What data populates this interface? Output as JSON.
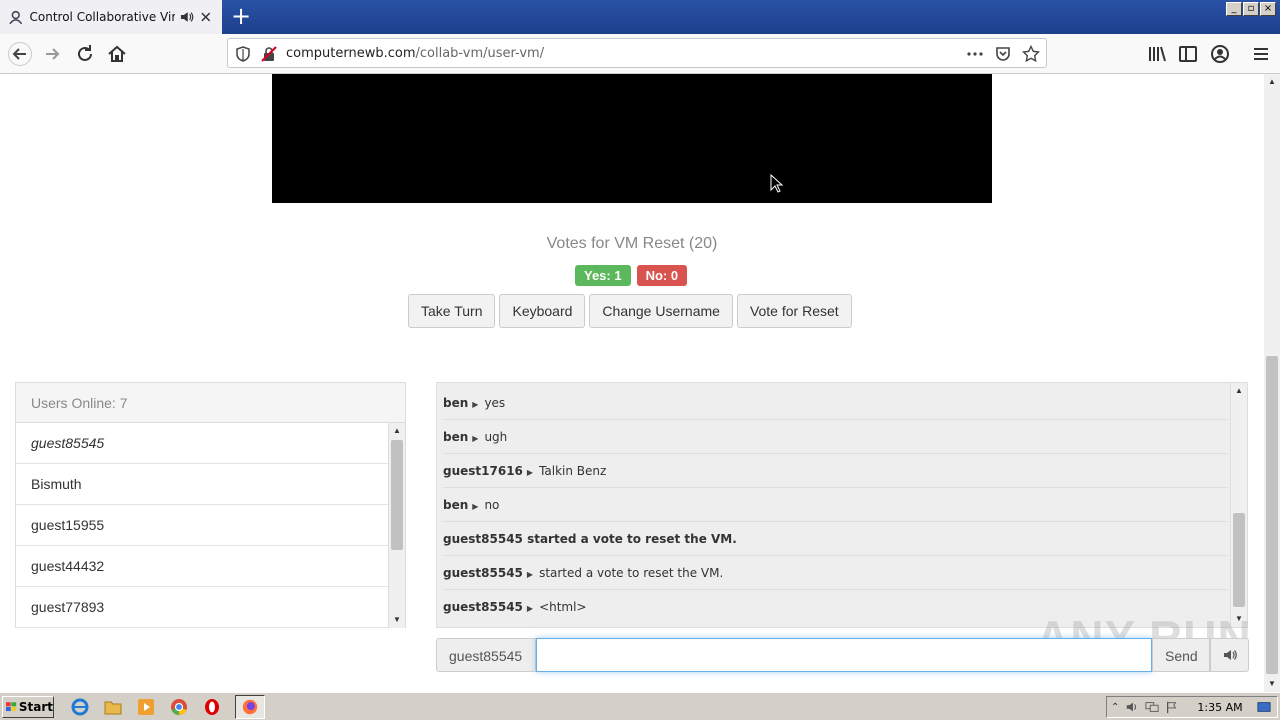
{
  "browser": {
    "tab_title": "Control Collaborative Virtual M",
    "url_domain": "computernewb.com",
    "url_path": "/collab-vm/user-vm/",
    "window_buttons": [
      "_",
      "▫",
      "×"
    ]
  },
  "vote": {
    "title": "Votes for VM Reset (20)",
    "yes_label": "Yes: 1",
    "no_label": "No: 0"
  },
  "buttons": {
    "take_turn": "Take Turn",
    "keyboard": "Keyboard",
    "change_username": "Change Username",
    "vote_reset": "Vote for Reset"
  },
  "users": {
    "header": "Users Online: 7",
    "list": [
      "guest85545",
      "Bismuth",
      "guest15955",
      "guest44432",
      "guest77893"
    ]
  },
  "chat": {
    "messages": [
      {
        "nick": "ben",
        "text": "yes"
      },
      {
        "nick": "ben",
        "text": "ugh"
      },
      {
        "nick": "guest17616",
        "text": "Talkin Benz"
      },
      {
        "nick": "ben",
        "text": "no"
      },
      {
        "system": "guest85545 started a vote to reset the VM."
      },
      {
        "nick": "guest85545",
        "text": "started a vote to reset the VM."
      },
      {
        "nick": "guest85545",
        "text": "<html>"
      }
    ],
    "username": "guest85545",
    "input_value": "",
    "send_label": "Send"
  },
  "watermark": "ANY RUN",
  "taskbar": {
    "start_label": "Start",
    "clock": "1:35 AM"
  },
  "colors": {
    "yes": "#5cb85c",
    "no": "#d9534f",
    "title_bar": "#2a52a6"
  }
}
